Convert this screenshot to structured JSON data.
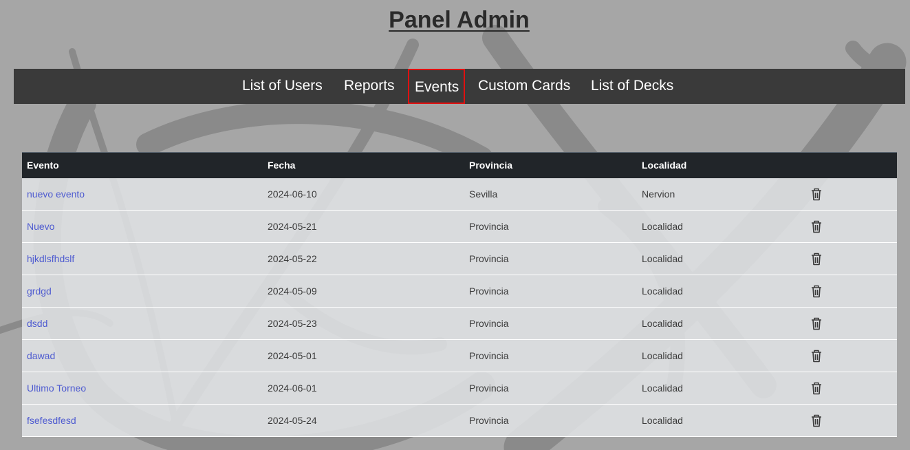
{
  "page": {
    "title": "Panel Admin"
  },
  "nav": {
    "items": [
      {
        "label": "List of Users"
      },
      {
        "label": "Reports"
      },
      {
        "label": "Events",
        "active": true
      },
      {
        "label": "Custom Cards"
      },
      {
        "label": "List of Decks"
      }
    ]
  },
  "table": {
    "headers": [
      "Evento",
      "Fecha",
      "Provincia",
      "Localidad",
      ""
    ],
    "rows": [
      {
        "evento": "nuevo evento",
        "fecha": "2024-06-10",
        "provincia": "Sevilla",
        "localidad": "Nervion"
      },
      {
        "evento": "Nuevo",
        "fecha": "2024-05-21",
        "provincia": "Provincia",
        "localidad": "Localidad"
      },
      {
        "evento": "hjkdlsfhdslf",
        "fecha": "2024-05-22",
        "provincia": "Provincia",
        "localidad": "Localidad"
      },
      {
        "evento": "grdgd",
        "fecha": "2024-05-09",
        "provincia": "Provincia",
        "localidad": "Localidad"
      },
      {
        "evento": "dsdd",
        "fecha": "2024-05-23",
        "provincia": "Provincia",
        "localidad": "Localidad"
      },
      {
        "evento": "dawad",
        "fecha": "2024-05-01",
        "provincia": "Provincia",
        "localidad": "Localidad"
      },
      {
        "evento": "Ultimo Torneo",
        "fecha": "2024-06-01",
        "provincia": "Provincia",
        "localidad": "Localidad"
      },
      {
        "evento": "fsefesdfesd",
        "fecha": "2024-05-24",
        "provincia": "Provincia",
        "localidad": "Localidad"
      }
    ]
  },
  "icons": {
    "delete": "trash-icon"
  },
  "colors": {
    "background": "#a6a6a6",
    "navbar": "#3a3a3a",
    "active_nav_border": "#e01010",
    "table_header": "#212529",
    "link": "#4e5bd0"
  }
}
